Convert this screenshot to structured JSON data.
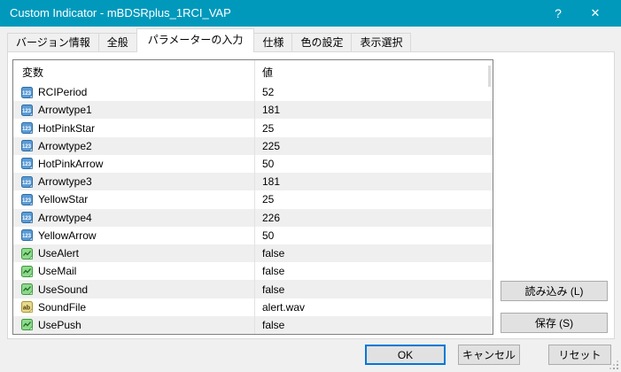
{
  "window": {
    "title": "Custom Indicator - mBDSRplus_1RCI_VAP",
    "help": "?",
    "close": "✕"
  },
  "tabs": [
    {
      "label": "バージョン情報",
      "active": false
    },
    {
      "label": "全般",
      "active": false
    },
    {
      "label": "パラメーターの入力",
      "active": true
    },
    {
      "label": "仕様",
      "active": false
    },
    {
      "label": "色の設定",
      "active": false
    },
    {
      "label": "表示選択",
      "active": false
    }
  ],
  "table": {
    "columns": [
      "変数",
      "値"
    ],
    "rows": [
      {
        "icon": "numeric-123-icon",
        "type": "int",
        "name": "RCIPeriod",
        "value": "52"
      },
      {
        "icon": "numeric-123-icon",
        "type": "int",
        "name": "Arrowtype1",
        "value": "181"
      },
      {
        "icon": "numeric-123-icon",
        "type": "int",
        "name": "HotPinkStar",
        "value": "25"
      },
      {
        "icon": "numeric-123-icon",
        "type": "int",
        "name": "Arrowtype2",
        "value": "225"
      },
      {
        "icon": "numeric-123-icon",
        "type": "int",
        "name": "HotPinkArrow",
        "value": "50"
      },
      {
        "icon": "numeric-123-icon",
        "type": "int",
        "name": "Arrowtype3",
        "value": "181"
      },
      {
        "icon": "numeric-123-icon",
        "type": "int",
        "name": "YellowStar",
        "value": "25"
      },
      {
        "icon": "numeric-123-icon",
        "type": "int",
        "name": "Arrowtype4",
        "value": "226"
      },
      {
        "icon": "numeric-123-icon",
        "type": "int",
        "name": "YellowArrow",
        "value": "50"
      },
      {
        "icon": "bool-chart-icon",
        "type": "bool",
        "name": "UseAlert",
        "value": "false"
      },
      {
        "icon": "bool-chart-icon",
        "type": "bool",
        "name": "UseMail",
        "value": "false"
      },
      {
        "icon": "bool-chart-icon",
        "type": "bool",
        "name": "UseSound",
        "value": "false"
      },
      {
        "icon": "string-ab-icon",
        "type": "string",
        "name": "SoundFile",
        "value": "alert.wav"
      },
      {
        "icon": "bool-chart-icon",
        "type": "bool",
        "name": "UsePush",
        "value": "false"
      }
    ]
  },
  "side_buttons": {
    "load": "読み込み (L)",
    "save": "保存 (S)"
  },
  "footer_buttons": {
    "ok": "OK",
    "cancel": "キャンセル",
    "reset": "リセット"
  },
  "colors": {
    "titlebar": "#0099bc",
    "titlebar_text": "#ffffff",
    "focus_border": "#0078d7",
    "row_stripe": "#efefef",
    "numeric_icon": "#5b9bd5",
    "bool_icon": "#8fd98f",
    "string_icon": "#e8da8f"
  }
}
